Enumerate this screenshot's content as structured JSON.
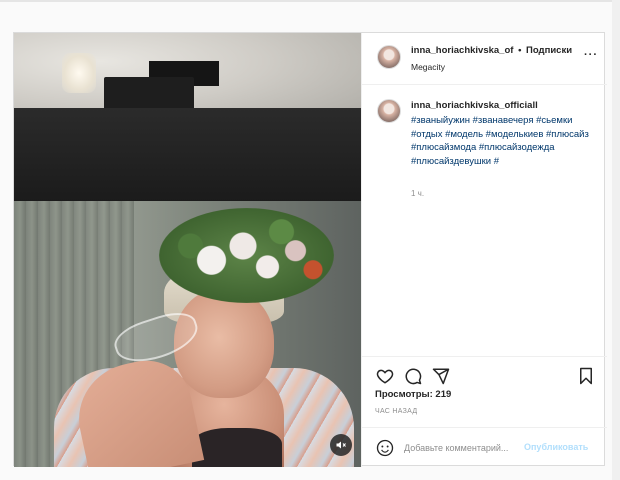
{
  "post": {
    "header": {
      "username": "inna_horiachkivska_of",
      "separator": "•",
      "follow_label": "Подписки",
      "location": "Megacity",
      "more_label": "···"
    },
    "caption": {
      "username": "inna_horiachkivska_officiall",
      "hashtags": "#званыйужин #званавечеря #сьемки #отдых #модель #моделькиев #плюсайз #плюсайзмода #плюсайзодежда #плюсайздевушки #",
      "time": "1 ч."
    },
    "actions": {
      "like_icon": "heart-icon",
      "comment_icon": "comment-icon",
      "share_icon": "share-icon",
      "save_icon": "bookmark-icon"
    },
    "views_label": "Просмотры: 219",
    "time_ago": "ЧАС НАЗАД",
    "comment": {
      "placeholder": "Добавьте комментарий...",
      "publish_label": "Опубликовать"
    }
  },
  "colors": {
    "link": "#00376b",
    "muted": "#8e8e8e",
    "publish_disabled": "#b2dffc",
    "border": "#dbdbdb"
  }
}
